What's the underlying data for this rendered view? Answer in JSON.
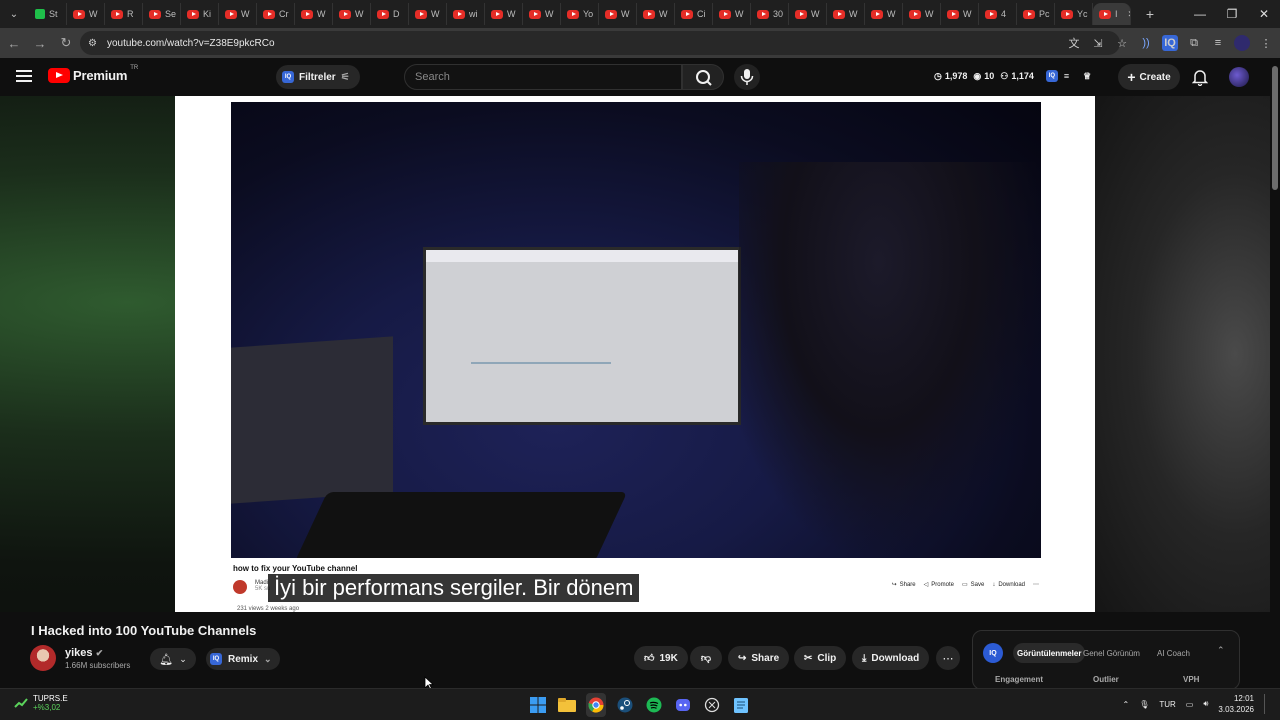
{
  "browser": {
    "tabs": [
      {
        "label": "St",
        "fav": "green"
      },
      {
        "label": "W",
        "fav": "yt"
      },
      {
        "label": "R",
        "fav": "yt"
      },
      {
        "label": "Se",
        "fav": "yt"
      },
      {
        "label": "Ki",
        "fav": "yt"
      },
      {
        "label": "W",
        "fav": "yt"
      },
      {
        "label": "Cr",
        "fav": "yt"
      },
      {
        "label": "W",
        "fav": "yt"
      },
      {
        "label": "W",
        "fav": "yt"
      },
      {
        "label": "D",
        "fav": "yt"
      },
      {
        "label": "W",
        "fav": "yt"
      },
      {
        "label": "wi",
        "fav": "yt"
      },
      {
        "label": "W",
        "fav": "yt"
      },
      {
        "label": "W",
        "fav": "yt"
      },
      {
        "label": "Yo",
        "fav": "yt"
      },
      {
        "label": "W",
        "fav": "yt"
      },
      {
        "label": "W",
        "fav": "yt"
      },
      {
        "label": "Ci",
        "fav": "yt"
      },
      {
        "label": "W",
        "fav": "yt"
      },
      {
        "label": "30",
        "fav": "yt"
      },
      {
        "label": "W",
        "fav": "yt"
      },
      {
        "label": "W",
        "fav": "yt"
      },
      {
        "label": "W",
        "fav": "yt"
      },
      {
        "label": "W",
        "fav": "yt"
      },
      {
        "label": "W",
        "fav": "yt"
      },
      {
        "label": "4",
        "fav": "yt"
      },
      {
        "label": "Pc",
        "fav": "yt"
      },
      {
        "label": "Yc",
        "fav": "yt"
      },
      {
        "label": "I",
        "fav": "yt",
        "active": true
      }
    ],
    "url": "youtube.com/watch?v=Z38E9pkcRCo"
  },
  "header": {
    "logo_text": "Premium",
    "logo_sup": "TR",
    "filter_label": "Filtreler",
    "search_placeholder": "Search",
    "stats": {
      "views": "1,978",
      "count": "10",
      "total": "1,174"
    },
    "create_label": "Create"
  },
  "video_frame": {
    "inner_title": "how to fix your YouTube channel",
    "inner_channel": "Madi",
    "inner_subs": "5K su",
    "inner_views": "231 views  2 weeks ago",
    "inner_actions": [
      "Share",
      "Promote",
      "Save",
      "Download"
    ]
  },
  "subtitle": "İyi bir performans sergiler.  Bir dönem",
  "video": {
    "title": "I Hacked into 100 YouTube Channels",
    "channel": "yikes",
    "subscribers": "1.66M subscribers",
    "remix_label": "Remix",
    "likes": "19K",
    "share_label": "Share",
    "clip_label": "Clip",
    "download_label": "Download"
  },
  "iq_panel": {
    "tabs": [
      "Görüntülenmeler",
      "Genel Görünüm",
      "AI Coach"
    ],
    "columns": [
      "Engagement",
      "Outlier",
      "VPH"
    ]
  },
  "taskbar": {
    "stock_name": "TUPRS.E",
    "stock_change": "+%3,02",
    "lang": "TUR",
    "time": "12:01",
    "date": "3.03.2026"
  },
  "colors": {
    "youtube_red": "#ff0000",
    "iq_blue": "#3767d6",
    "stock_green": "#5bd35b"
  }
}
